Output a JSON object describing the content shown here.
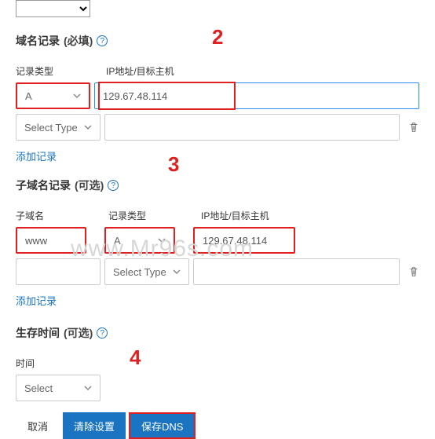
{
  "top_select_value": "",
  "section1": {
    "title": "域名记录",
    "required": "(必填)",
    "label_type": "记录类型",
    "label_ip": "IP地址/目标主机",
    "row1_type": "A",
    "row1_ip": "129.67.48.114",
    "row2_type_placeholder": "Select Type",
    "row2_ip": "",
    "add_link": "添加记录"
  },
  "section2": {
    "title": "子域名记录",
    "optional": "(可选)",
    "label_sub": "子域名",
    "label_type": "记录类型",
    "label_ip": "IP地址/目标主机",
    "row1_sub": "www",
    "row1_type": "A",
    "row1_ip": "129.67.48.114",
    "row2_sub": "",
    "row2_type_placeholder": "Select Type",
    "row2_ip": "",
    "add_link": "添加记录"
  },
  "section3": {
    "title": "生存时间",
    "optional": "(可选)",
    "label_time": "时间",
    "select_placeholder": "Select"
  },
  "buttons": {
    "cancel": "取消",
    "clear": "清除设置",
    "save": "保存DNS"
  },
  "callouts": {
    "c2": "2",
    "c3": "3",
    "c4": "4"
  },
  "watermark": "www.Mr96s.com"
}
